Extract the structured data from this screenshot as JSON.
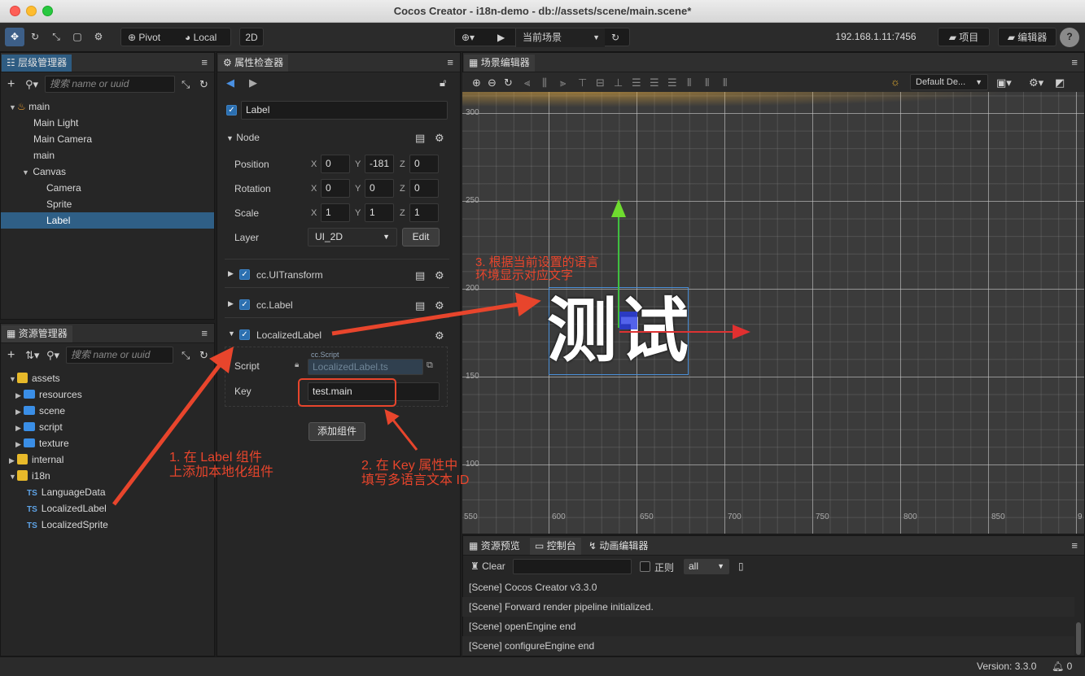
{
  "window": {
    "title": "Cocos Creator - i18n-demo - db://assets/scene/main.scene*"
  },
  "toolbar": {
    "pivot": "Pivot",
    "local": "Local",
    "mode_2d": "2D",
    "scene_select": "当前场景",
    "ip": "192.168.1.11:7456",
    "project": "项目",
    "editor": "编辑器"
  },
  "hierarchy": {
    "tab": "层级管理器",
    "search_placeholder": "搜索 name or uuid",
    "items": [
      "main",
      "Main Light",
      "Main Camera",
      "main",
      "Canvas",
      "Camera",
      "Sprite",
      "Label"
    ]
  },
  "assets": {
    "tab": "资源管理器",
    "search_placeholder": "搜索 name or uuid",
    "items": [
      "assets",
      "resources",
      "scene",
      "script",
      "texture",
      "internal",
      "i18n",
      "LanguageData",
      "LocalizedLabel",
      "LocalizedSprite"
    ],
    "ts_badge": "TS"
  },
  "inspector": {
    "tab": "属性检查器",
    "node_name": "Label",
    "node_section": "Node",
    "position_label": "Position",
    "rotation_label": "Rotation",
    "scale_label": "Scale",
    "layer_label": "Layer",
    "axis_x": "X",
    "axis_y": "Y",
    "axis_z": "Z",
    "position": {
      "x": "0",
      "y": "-181",
      "z": "0"
    },
    "rotation": {
      "x": "0",
      "y": "0",
      "z": "0"
    },
    "scale": {
      "x": "1",
      "y": "1",
      "z": "1"
    },
    "layer_value": "UI_2D",
    "edit_button": "Edit",
    "comp_uitransform": "cc.UITransform",
    "comp_label": "cc.Label",
    "comp_localized": "LocalizedLabel",
    "script_label": "Script",
    "script_badge": "cc.Script",
    "script_value": "LocalizedLabel.ts",
    "key_label": "Key",
    "key_value": "test.main",
    "add_component": "添加组件"
  },
  "scene_editor": {
    "tab": "场景编辑器",
    "camera_select": "Default De...",
    "ruler_y": [
      "300",
      "250",
      "200",
      "150",
      "100"
    ],
    "ruler_x": [
      "550",
      "600",
      "650",
      "700",
      "750",
      "800",
      "850",
      "9"
    ],
    "label_text": "测试"
  },
  "console": {
    "tabs": [
      "资源预览",
      "控制台",
      "动画编辑器"
    ],
    "clear": "Clear",
    "regex": "正则",
    "filter": "all",
    "logs": [
      "[Scene] Cocos Creator v3.3.0",
      "[Scene] Forward render pipeline initialized.",
      "[Scene] openEngine end",
      "[Scene] configureEngine end"
    ]
  },
  "status": {
    "version": "Version: 3.3.0",
    "notifications": "0"
  },
  "annotations": {
    "a1_line1": "1. 在 Label 组件",
    "a1_line2": "上添加本地化组件",
    "a2_line1": "2. 在 Key 属性中",
    "a2_line2": "填写多语言文本 ID",
    "a3_line1": "3. 根据当前设置的语言",
    "a3_line2": "环境显示对应文字"
  },
  "colors": {
    "accent": "#2f5f86",
    "annotation": "#e8452c",
    "selection": "#3d5f88"
  }
}
